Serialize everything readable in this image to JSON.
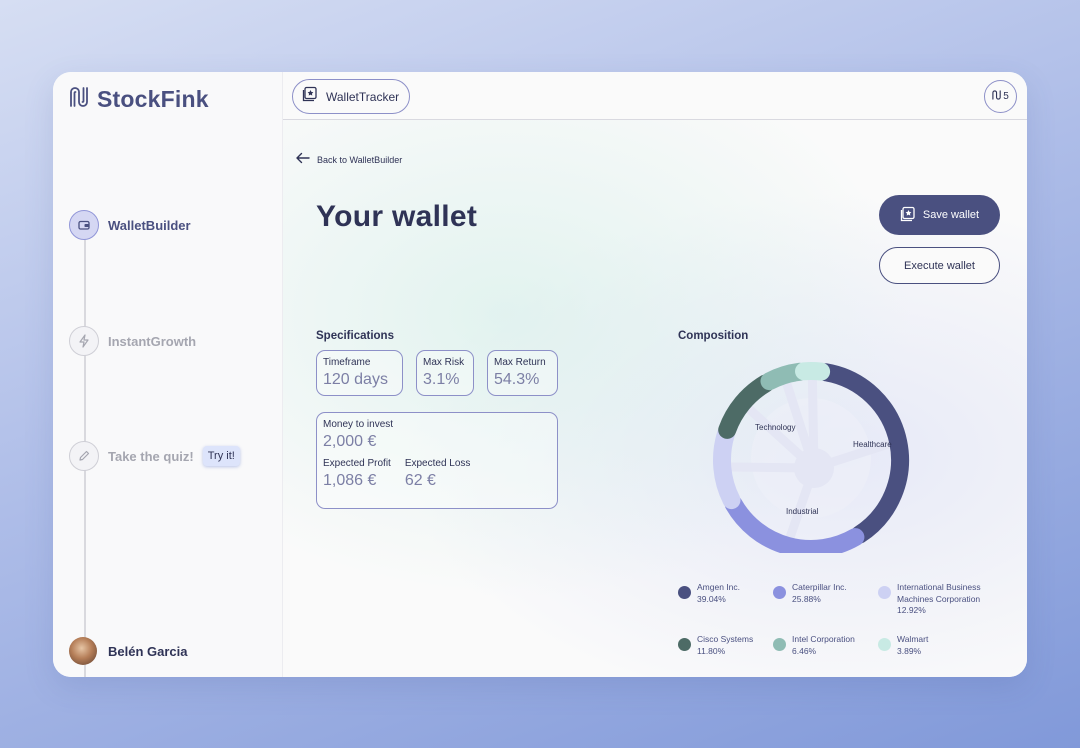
{
  "app": {
    "name": "StockFink"
  },
  "topbar": {
    "tab_label": "WalletTracker",
    "counter": "5"
  },
  "sidebar": {
    "steps": [
      {
        "label": "WalletBuilder",
        "active": true
      },
      {
        "label": "InstantGrowth",
        "active": false
      },
      {
        "label": "Take the quiz!",
        "active": false,
        "badge": "Try it!"
      }
    ],
    "user": {
      "name": "Belén Garcia"
    }
  },
  "main": {
    "back_label": "Back to WalletBuilder",
    "title": "Your wallet",
    "save_label": "Save wallet",
    "execute_label": "Execute wallet",
    "specs": {
      "title": "Specifications",
      "timeframe_label": "Timeframe",
      "timeframe_value": "120 days",
      "max_risk_label": "Max Risk",
      "max_risk_value": "3.1%",
      "max_return_label": "Max Return",
      "max_return_value": "54.3%",
      "money_label": "Money to invest",
      "money_value": "2,000 €",
      "profit_label": "Expected Profit",
      "profit_value": "1,086 €",
      "loss_label": "Expected Loss",
      "loss_value": "62 €"
    },
    "composition": {
      "title": "Composition",
      "sector_labels": {
        "technology": "Technology",
        "healthcare": "Healthcare",
        "industrial": "Industrial"
      }
    }
  },
  "chart_data": {
    "type": "pie",
    "style": "donut",
    "title": "Composition",
    "categories": [
      "Amgen Inc.",
      "Caterpillar Inc.",
      "International Business Machines Corporation",
      "Cisco Systems",
      "Intel Corporation",
      "Walmart"
    ],
    "values": [
      39.04,
      25.88,
      12.92,
      11.8,
      6.46,
      3.89
    ],
    "value_labels": [
      "39.04%",
      "25.88%",
      "12.92%",
      "11.80%",
      "6.46%",
      "3.89%"
    ],
    "colors": [
      "#4a5080",
      "#8b91df",
      "#cdd1f3",
      "#4d6b66",
      "#8fbcb4",
      "#c8eae4"
    ],
    "groups": [
      {
        "name": "Healthcare",
        "members": [
          "Amgen Inc."
        ]
      },
      {
        "name": "Industrial",
        "members": [
          "Caterpillar Inc."
        ]
      },
      {
        "name": "Technology",
        "members": [
          "International Business Machines Corporation",
          "Cisco Systems",
          "Intel Corporation",
          "Walmart"
        ]
      }
    ],
    "legend": "bottom"
  }
}
